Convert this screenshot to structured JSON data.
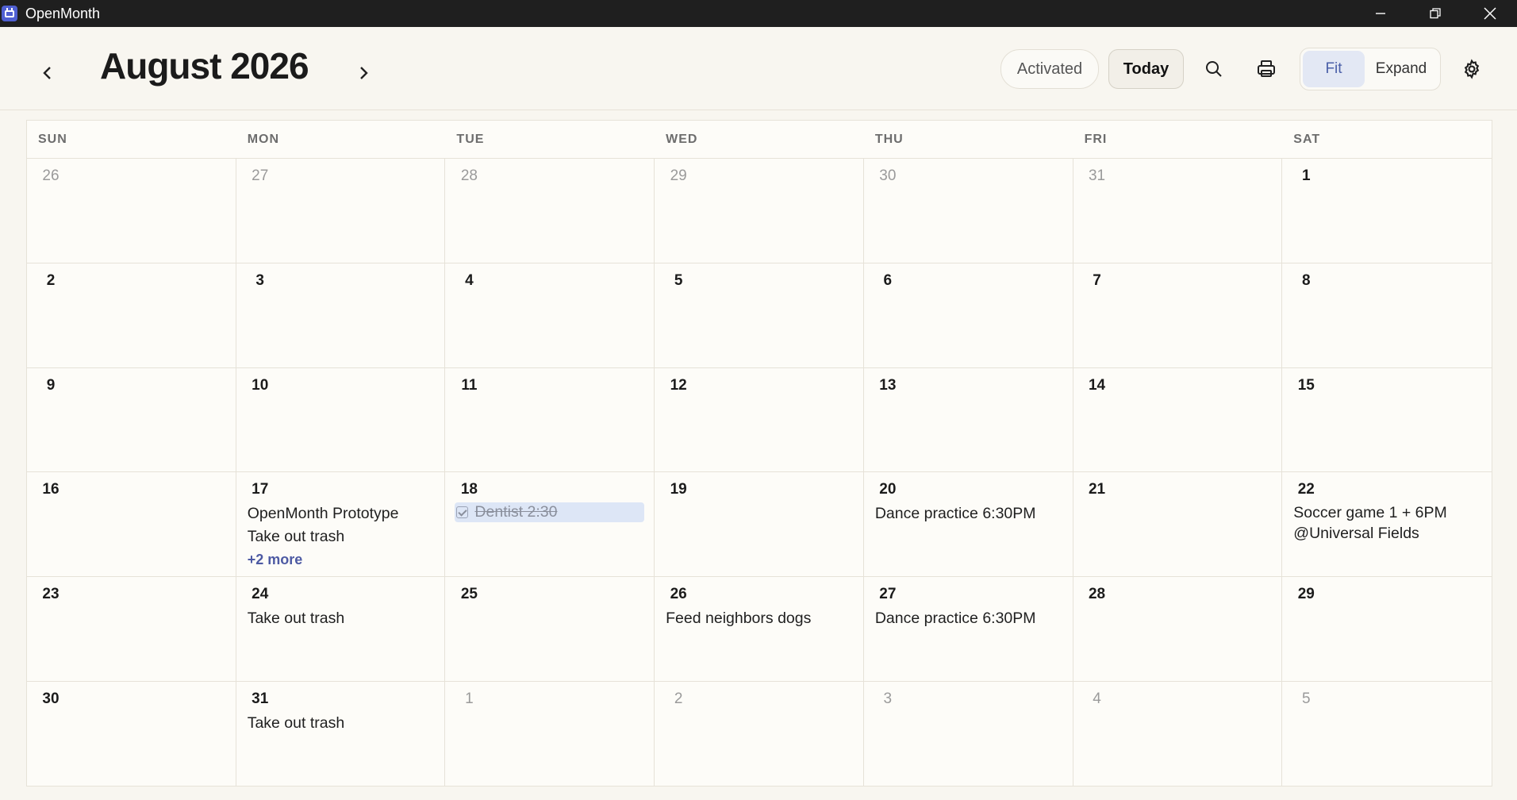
{
  "window": {
    "title": "OpenMonth"
  },
  "header": {
    "month_title": "August 2026",
    "activated_label": "Activated",
    "today_label": "Today",
    "view_fit_label": "Fit",
    "view_expand_label": "Expand",
    "selected_view": "Fit"
  },
  "colors": {
    "accent": "#4f5fd1",
    "selected_view_bg": "#e3e8f4",
    "done_event_bg": "#dde6f6",
    "more_link": "#4d5aa3"
  },
  "weekdays": [
    "SUN",
    "MON",
    "TUE",
    "WED",
    "THU",
    "FRI",
    "SAT"
  ],
  "weeks": [
    {
      "days": [
        {
          "num": "26",
          "other": true,
          "events": []
        },
        {
          "num": "27",
          "other": true,
          "events": []
        },
        {
          "num": "28",
          "other": true,
          "events": []
        },
        {
          "num": "29",
          "other": true,
          "events": []
        },
        {
          "num": "30",
          "other": true,
          "events": []
        },
        {
          "num": "31",
          "other": true,
          "events": []
        },
        {
          "num": "1",
          "other": false,
          "events": []
        }
      ]
    },
    {
      "days": [
        {
          "num": "2",
          "other": false,
          "events": []
        },
        {
          "num": "3",
          "other": false,
          "events": []
        },
        {
          "num": "4",
          "other": false,
          "events": []
        },
        {
          "num": "5",
          "other": false,
          "events": []
        },
        {
          "num": "6",
          "other": false,
          "events": []
        },
        {
          "num": "7",
          "other": false,
          "events": []
        },
        {
          "num": "8",
          "other": false,
          "events": []
        }
      ]
    },
    {
      "days": [
        {
          "num": "9",
          "other": false,
          "events": []
        },
        {
          "num": "10",
          "other": false,
          "events": []
        },
        {
          "num": "11",
          "other": false,
          "events": []
        },
        {
          "num": "12",
          "other": false,
          "events": []
        },
        {
          "num": "13",
          "other": false,
          "events": []
        },
        {
          "num": "14",
          "other": false,
          "events": []
        },
        {
          "num": "15",
          "other": false,
          "events": []
        }
      ]
    },
    {
      "days": [
        {
          "num": "16",
          "other": false,
          "events": []
        },
        {
          "num": "17",
          "other": false,
          "events": [
            {
              "text": "OpenMonth Prototype"
            },
            {
              "text": "Take out trash"
            }
          ],
          "more": "+2 more"
        },
        {
          "num": "18",
          "other": false,
          "events": [
            {
              "text": "Dentist 2:30",
              "done": true
            }
          ]
        },
        {
          "num": "19",
          "other": false,
          "events": []
        },
        {
          "num": "20",
          "other": false,
          "events": [
            {
              "text": "Dance practice 6:30PM"
            }
          ]
        },
        {
          "num": "21",
          "other": false,
          "events": []
        },
        {
          "num": "22",
          "other": false,
          "events": [
            {
              "text": "Soccer game 1 + 6PM @Universal Fields",
              "wrap": true
            }
          ]
        }
      ]
    },
    {
      "days": [
        {
          "num": "23",
          "other": false,
          "events": []
        },
        {
          "num": "24",
          "other": false,
          "events": [
            {
              "text": "Take out trash"
            }
          ]
        },
        {
          "num": "25",
          "other": false,
          "events": []
        },
        {
          "num": "26",
          "other": false,
          "events": [
            {
              "text": "Feed neighbors dogs"
            }
          ]
        },
        {
          "num": "27",
          "other": false,
          "events": [
            {
              "text": "Dance practice 6:30PM"
            }
          ]
        },
        {
          "num": "28",
          "other": false,
          "events": []
        },
        {
          "num": "29",
          "other": false,
          "events": []
        }
      ]
    },
    {
      "days": [
        {
          "num": "30",
          "other": false,
          "events": []
        },
        {
          "num": "31",
          "other": false,
          "events": [
            {
              "text": "Take out trash"
            }
          ]
        },
        {
          "num": "1",
          "other": true,
          "events": []
        },
        {
          "num": "2",
          "other": true,
          "events": []
        },
        {
          "num": "3",
          "other": true,
          "events": []
        },
        {
          "num": "4",
          "other": true,
          "events": []
        },
        {
          "num": "5",
          "other": true,
          "events": []
        }
      ]
    }
  ]
}
